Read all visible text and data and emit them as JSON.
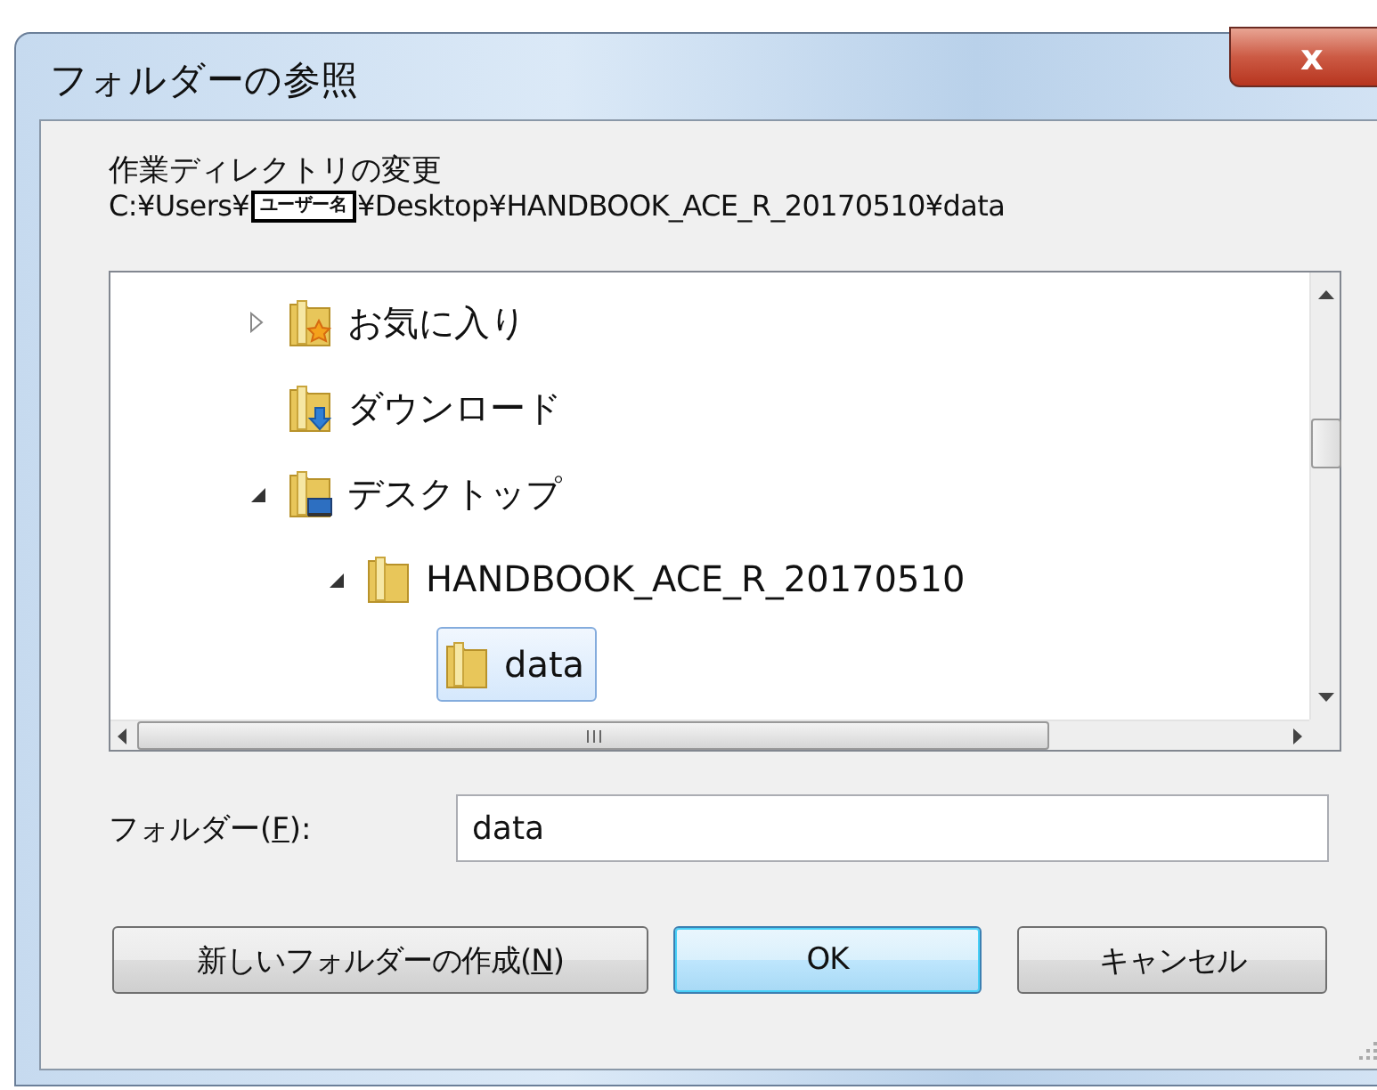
{
  "window": {
    "title": "フォルダーの参照",
    "close": "x"
  },
  "description": {
    "heading": "作業ディレクトリの変更",
    "path_prefix": "C:¥Users¥",
    "path_redacted": "ユーザー名",
    "path_suffix": "¥Desktop¥HANDBOOK_ACE_R_20170510¥data"
  },
  "tree": {
    "items": [
      {
        "label": "お気に入り",
        "kind": "favorites",
        "expandable": true,
        "expanded": false,
        "selected": false
      },
      {
        "label": "ダウンロード",
        "kind": "downloads",
        "expandable": false,
        "expanded": false,
        "selected": false
      },
      {
        "label": "デスクトップ",
        "kind": "desktop",
        "expandable": true,
        "expanded": true,
        "selected": false,
        "children": [
          {
            "label": "HANDBOOK_ACE_R_20170510",
            "kind": "folder",
            "expandable": true,
            "expanded": true,
            "selected": false,
            "children": [
              {
                "label": "data",
                "kind": "folder",
                "expandable": false,
                "expanded": false,
                "selected": true
              }
            ]
          }
        ]
      }
    ]
  },
  "folder_field": {
    "label_before": "フォルダー(",
    "access_key": "F",
    "label_after": "):",
    "value": "data"
  },
  "buttons": [
    {
      "label_before": "新しいフォルダーの作成(",
      "access_key": "N",
      "label_after": ")",
      "default": false
    },
    {
      "label_before": "OK",
      "default": true
    },
    {
      "label_before": "キャンセル",
      "default": false
    }
  ]
}
